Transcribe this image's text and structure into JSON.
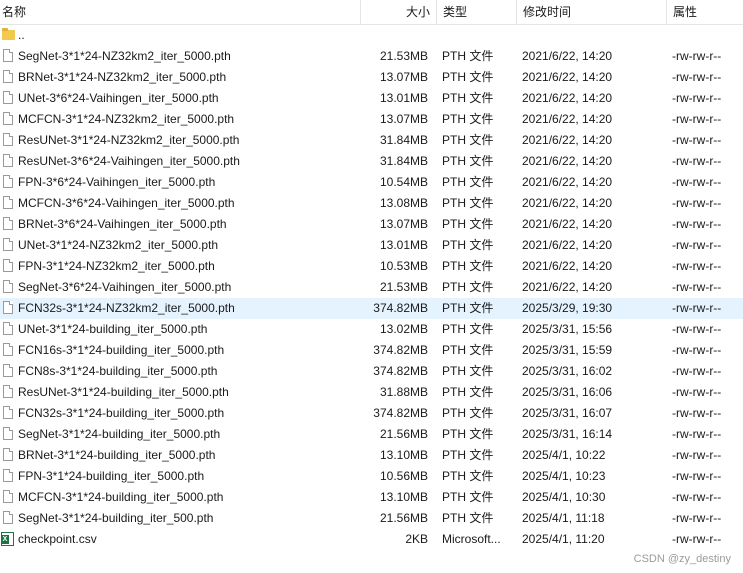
{
  "columns": {
    "name": "名称",
    "size": "大小",
    "type": "类型",
    "date": "修改时间",
    "attr": "属性"
  },
  "sort_indicator": "^",
  "parent_dir": "..",
  "files": [
    {
      "name": "SegNet-3*1*24-NZ32km2_iter_5000.pth",
      "size": "21.53MB",
      "type": "PTH 文件",
      "date": "2021/6/22, 14:20",
      "attr": "-rw-rw-r--",
      "icon": "file-icon"
    },
    {
      "name": "BRNet-3*1*24-NZ32km2_iter_5000.pth",
      "size": "13.07MB",
      "type": "PTH 文件",
      "date": "2021/6/22, 14:20",
      "attr": "-rw-rw-r--",
      "icon": "file-icon"
    },
    {
      "name": "UNet-3*6*24-Vaihingen_iter_5000.pth",
      "size": "13.01MB",
      "type": "PTH 文件",
      "date": "2021/6/22, 14:20",
      "attr": "-rw-rw-r--",
      "icon": "file-icon"
    },
    {
      "name": "MCFCN-3*1*24-NZ32km2_iter_5000.pth",
      "size": "13.07MB",
      "type": "PTH 文件",
      "date": "2021/6/22, 14:20",
      "attr": "-rw-rw-r--",
      "icon": "file-icon"
    },
    {
      "name": "ResUNet-3*1*24-NZ32km2_iter_5000.pth",
      "size": "31.84MB",
      "type": "PTH 文件",
      "date": "2021/6/22, 14:20",
      "attr": "-rw-rw-r--",
      "icon": "file-icon"
    },
    {
      "name": "ResUNet-3*6*24-Vaihingen_iter_5000.pth",
      "size": "31.84MB",
      "type": "PTH 文件",
      "date": "2021/6/22, 14:20",
      "attr": "-rw-rw-r--",
      "icon": "file-icon"
    },
    {
      "name": "FPN-3*6*24-Vaihingen_iter_5000.pth",
      "size": "10.54MB",
      "type": "PTH 文件",
      "date": "2021/6/22, 14:20",
      "attr": "-rw-rw-r--",
      "icon": "file-icon"
    },
    {
      "name": "MCFCN-3*6*24-Vaihingen_iter_5000.pth",
      "size": "13.08MB",
      "type": "PTH 文件",
      "date": "2021/6/22, 14:20",
      "attr": "-rw-rw-r--",
      "icon": "file-icon"
    },
    {
      "name": "BRNet-3*6*24-Vaihingen_iter_5000.pth",
      "size": "13.07MB",
      "type": "PTH 文件",
      "date": "2021/6/22, 14:20",
      "attr": "-rw-rw-r--",
      "icon": "file-icon"
    },
    {
      "name": "UNet-3*1*24-NZ32km2_iter_5000.pth",
      "size": "13.01MB",
      "type": "PTH 文件",
      "date": "2021/6/22, 14:20",
      "attr": "-rw-rw-r--",
      "icon": "file-icon"
    },
    {
      "name": "FPN-3*1*24-NZ32km2_iter_5000.pth",
      "size": "10.53MB",
      "type": "PTH 文件",
      "date": "2021/6/22, 14:20",
      "attr": "-rw-rw-r--",
      "icon": "file-icon"
    },
    {
      "name": "SegNet-3*6*24-Vaihingen_iter_5000.pth",
      "size": "21.53MB",
      "type": "PTH 文件",
      "date": "2021/6/22, 14:20",
      "attr": "-rw-rw-r--",
      "icon": "file-icon"
    },
    {
      "name": "FCN32s-3*1*24-NZ32km2_iter_5000.pth",
      "size": "374.82MB",
      "type": "PTH 文件",
      "date": "2025/3/29, 19:30",
      "attr": "-rw-rw-r--",
      "icon": "file-icon",
      "selected": true
    },
    {
      "name": "UNet-3*1*24-building_iter_5000.pth",
      "size": "13.02MB",
      "type": "PTH 文件",
      "date": "2025/3/31, 15:56",
      "attr": "-rw-rw-r--",
      "icon": "file-icon"
    },
    {
      "name": "FCN16s-3*1*24-building_iter_5000.pth",
      "size": "374.82MB",
      "type": "PTH 文件",
      "date": "2025/3/31, 15:59",
      "attr": "-rw-rw-r--",
      "icon": "file-icon"
    },
    {
      "name": "FCN8s-3*1*24-building_iter_5000.pth",
      "size": "374.82MB",
      "type": "PTH 文件",
      "date": "2025/3/31, 16:02",
      "attr": "-rw-rw-r--",
      "icon": "file-icon"
    },
    {
      "name": "ResUNet-3*1*24-building_iter_5000.pth",
      "size": "31.88MB",
      "type": "PTH 文件",
      "date": "2025/3/31, 16:06",
      "attr": "-rw-rw-r--",
      "icon": "file-icon"
    },
    {
      "name": "FCN32s-3*1*24-building_iter_5000.pth",
      "size": "374.82MB",
      "type": "PTH 文件",
      "date": "2025/3/31, 16:07",
      "attr": "-rw-rw-r--",
      "icon": "file-icon"
    },
    {
      "name": "SegNet-3*1*24-building_iter_5000.pth",
      "size": "21.56MB",
      "type": "PTH 文件",
      "date": "2025/3/31, 16:14",
      "attr": "-rw-rw-r--",
      "icon": "file-icon"
    },
    {
      "name": "BRNet-3*1*24-building_iter_5000.pth",
      "size": "13.10MB",
      "type": "PTH 文件",
      "date": "2025/4/1, 10:22",
      "attr": "-rw-rw-r--",
      "icon": "file-icon"
    },
    {
      "name": "FPN-3*1*24-building_iter_5000.pth",
      "size": "10.56MB",
      "type": "PTH 文件",
      "date": "2025/4/1, 10:23",
      "attr": "-rw-rw-r--",
      "icon": "file-icon"
    },
    {
      "name": "MCFCN-3*1*24-building_iter_5000.pth",
      "size": "13.10MB",
      "type": "PTH 文件",
      "date": "2025/4/1, 10:30",
      "attr": "-rw-rw-r--",
      "icon": "file-icon"
    },
    {
      "name": "SegNet-3*1*24-building_iter_500.pth",
      "size": "21.56MB",
      "type": "PTH 文件",
      "date": "2025/4/1, 11:18",
      "attr": "-rw-rw-r--",
      "icon": "file-icon"
    },
    {
      "name": "checkpoint.csv",
      "size": "2KB",
      "type": "Microsoft...",
      "date": "2025/4/1, 11:20",
      "attr": "-rw-rw-r--",
      "icon": "excel-icon"
    }
  ],
  "watermark": "CSDN @zy_destiny",
  "colors": {
    "selected_row": "#e5f3ff",
    "folder": "#f2c94c",
    "excel": "#1e7145"
  }
}
